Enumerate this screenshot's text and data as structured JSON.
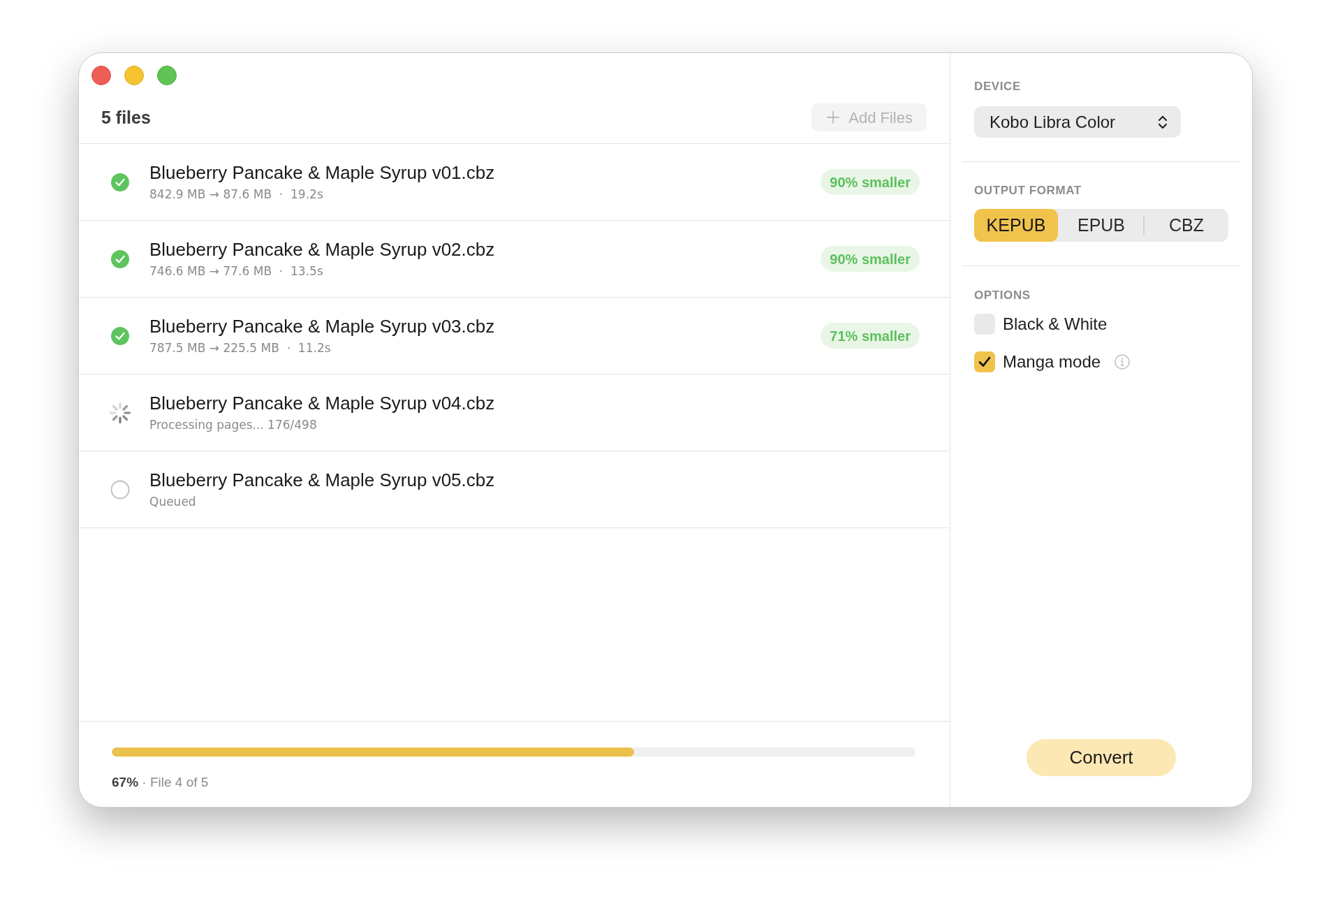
{
  "file_list": {
    "title": "5 files",
    "add_button": "Add Files",
    "files": [
      {
        "name": "Blueberry Pancake & Maple Syrup v01.cbz",
        "detail": "842.9 MB → 87.6 MB  ·  19.2s",
        "kind": "done",
        "badge": "90% smaller"
      },
      {
        "name": "Blueberry Pancake & Maple Syrup v02.cbz",
        "detail": "746.6 MB → 77.6 MB  ·  13.5s",
        "kind": "done",
        "badge": "90% smaller"
      },
      {
        "name": "Blueberry Pancake & Maple Syrup v03.cbz",
        "detail": "787.5 MB → 225.5 MB  ·  11.2s",
        "kind": "done",
        "badge": "71% smaller"
      },
      {
        "name": "Blueberry Pancake & Maple Syrup v04.cbz",
        "detail": "Processing pages... 176/498",
        "kind": "processing"
      },
      {
        "name": "Blueberry Pancake & Maple Syrup v05.cbz",
        "detail": "Queued",
        "kind": "queued"
      }
    ]
  },
  "progress": {
    "level": 0.65,
    "text": "**67%** · File 4 of 5"
  },
  "settings": {
    "device": {
      "label": "DEVICE",
      "value": "Kobo Libra Color"
    },
    "output_format": {
      "label": "OUTPUT FORMAT",
      "options": [
        {
          "label": "KEPUB",
          "selected": true
        },
        {
          "label": "EPUB",
          "selected": false
        },
        {
          "label": "CBZ",
          "selected": false
        }
      ]
    },
    "options": {
      "label": "OPTIONS",
      "items": [
        {
          "label": "Black & White",
          "checked": false
        },
        {
          "label": "Manga mode",
          "checked": true,
          "info": true
        }
      ]
    },
    "convert_button": "Convert"
  }
}
